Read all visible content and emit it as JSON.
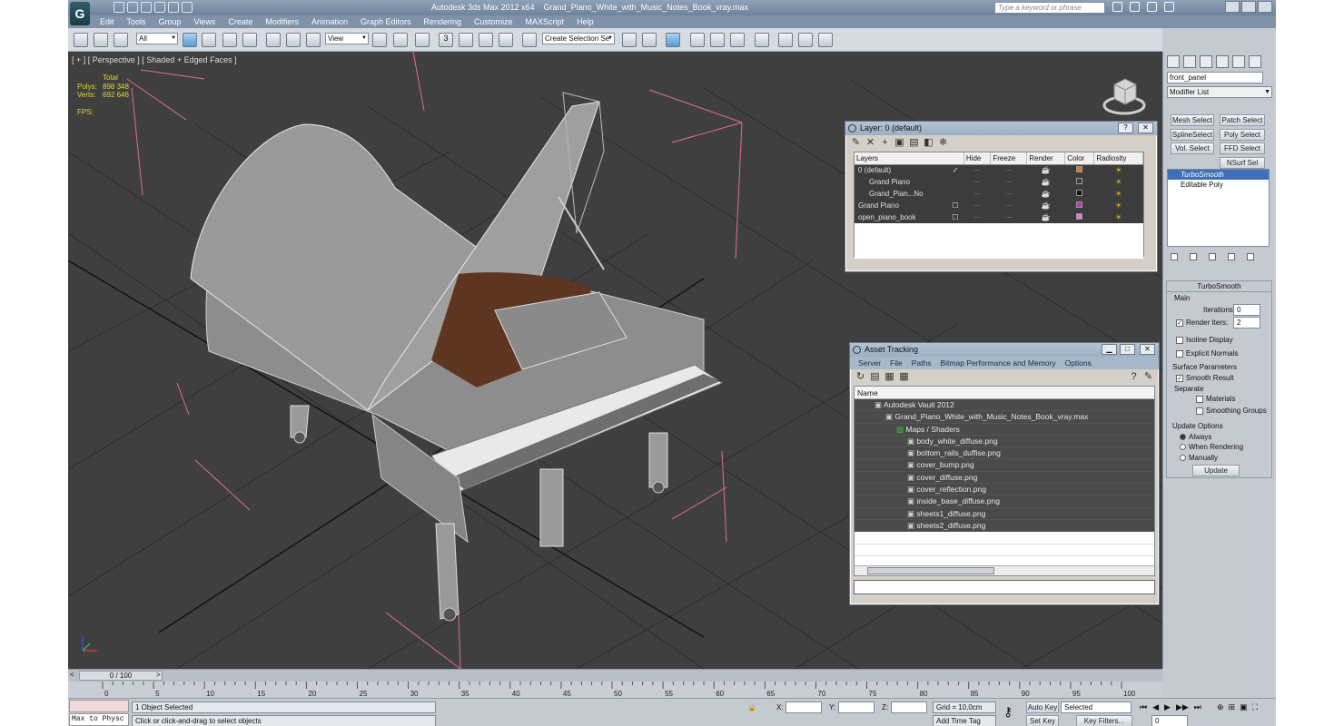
{
  "window": {
    "app_title": "Autodesk 3ds Max  2012 x64",
    "file_title": "Grand_Piano_White_with_Music_Notes_Book_vray.max",
    "search_placeholder": "Type a keyword or phrase"
  },
  "menu": [
    "Edit",
    "Tools",
    "Group",
    "Views",
    "Create",
    "Modifiers",
    "Animation",
    "Graph Editors",
    "Rendering",
    "Customize",
    "MAXScript",
    "Help"
  ],
  "toolbar": {
    "selection_filter": "All",
    "ref_coord": "View",
    "named_selection": "Create Selection Se",
    "snap_label": "3"
  },
  "viewport": {
    "label": "[ + ] [ Perspective ] [ Shaded + Edged Faces ]",
    "stats": {
      "total_label": "Total",
      "polys_label": "Polys:",
      "polys_value": "898 348",
      "verts_label": "Verts:",
      "verts_value": "692 646",
      "fps_label": "FPS:"
    }
  },
  "layer_panel": {
    "title": "Layer: 0 (default)",
    "columns": [
      "Layers",
      "Hide",
      "Freeze",
      "Render",
      "Color",
      "Radiosity"
    ],
    "rows": [
      {
        "name": "0 (default)",
        "indent": 0,
        "color": "#d9772f",
        "check": "✓"
      },
      {
        "name": "Grand Piano",
        "indent": 1,
        "color": "#3a3a3a",
        "check": ""
      },
      {
        "name": "Grand_Pian...No",
        "indent": 1,
        "color": "#111111",
        "check": ""
      },
      {
        "name": "Grand Piano",
        "indent": 0,
        "color": "#c62fc7",
        "check": "☐"
      },
      {
        "name": "open_piano_book",
        "indent": 0,
        "color": "#e07ad9",
        "check": "☐"
      }
    ]
  },
  "asset_panel": {
    "title": "Asset Tracking",
    "menu": [
      "Server",
      "File",
      "Paths",
      "Bitmap Performance and Memory",
      "Options"
    ],
    "column": "Name",
    "rows": [
      {
        "name": "Autodesk Vault 2012",
        "level": 1
      },
      {
        "name": "Grand_Piano_White_with_Music_Notes_Book_vray.max",
        "level": 2
      },
      {
        "name": "Maps / Shaders",
        "level": 3
      },
      {
        "name": "body_white_diffuse.png",
        "level": 4
      },
      {
        "name": "bottom_rails_duffise.png",
        "level": 4
      },
      {
        "name": "cover_bump.png",
        "level": 4
      },
      {
        "name": "cover_diffuse.png",
        "level": 4
      },
      {
        "name": "cover_reflection.png",
        "level": 4
      },
      {
        "name": "inside_base_diffuse.png",
        "level": 4
      },
      {
        "name": "sheets1_diffuse.png",
        "level": 4
      },
      {
        "name": "sheets2_diffuse.png",
        "level": 4
      }
    ]
  },
  "command_panel": {
    "object_name": "front_panel",
    "modifier_list": "Modifier List",
    "buttons": [
      "Mesh Select",
      "Patch Select",
      "SplineSelect",
      "Poly Select",
      "Vol. Select",
      "FFD Select",
      "NSurf Sel"
    ],
    "stack": [
      "TurboSmooth",
      "Editable Poly"
    ],
    "turbosmooth": {
      "title": "TurboSmooth",
      "main": "Main",
      "iterations_label": "Iterations:",
      "iterations": "0",
      "render_iters_label": "Render Iters:",
      "render_iters": "2",
      "isoline": "Isoline Display",
      "explicit": "Explicit Normals",
      "surface": "Surface Parameters",
      "smooth_result": "Smooth Result",
      "separate": "Separate",
      "materials": "Materials",
      "smoothing_groups": "Smoothing Groups",
      "update_options": "Update Options",
      "always": "Always",
      "when_rendering": "When Rendering",
      "manually": "Manually",
      "update": "Update"
    }
  },
  "timeline": {
    "frame": "0 / 100",
    "ticks": [
      "0",
      "5",
      "10",
      "15",
      "20",
      "25",
      "30",
      "35",
      "40",
      "45",
      "50",
      "55",
      "60",
      "65",
      "70",
      "75",
      "80",
      "85",
      "90",
      "95",
      "100"
    ]
  },
  "status": {
    "script_label": "Max to Physc",
    "selected": "1 Object Selected",
    "prompt": "Click or click-and-drag to select objects",
    "x_label": "X:",
    "y_label": "Y:",
    "z_label": "Z:",
    "grid": "Grid = 10,0cm",
    "add_time_tag": "Add Time Tag",
    "auto_key": "Auto Key",
    "set_key": "Set Key",
    "key_mode": "Selected",
    "key_filters": "Key Filters...",
    "frame_value": "0"
  }
}
